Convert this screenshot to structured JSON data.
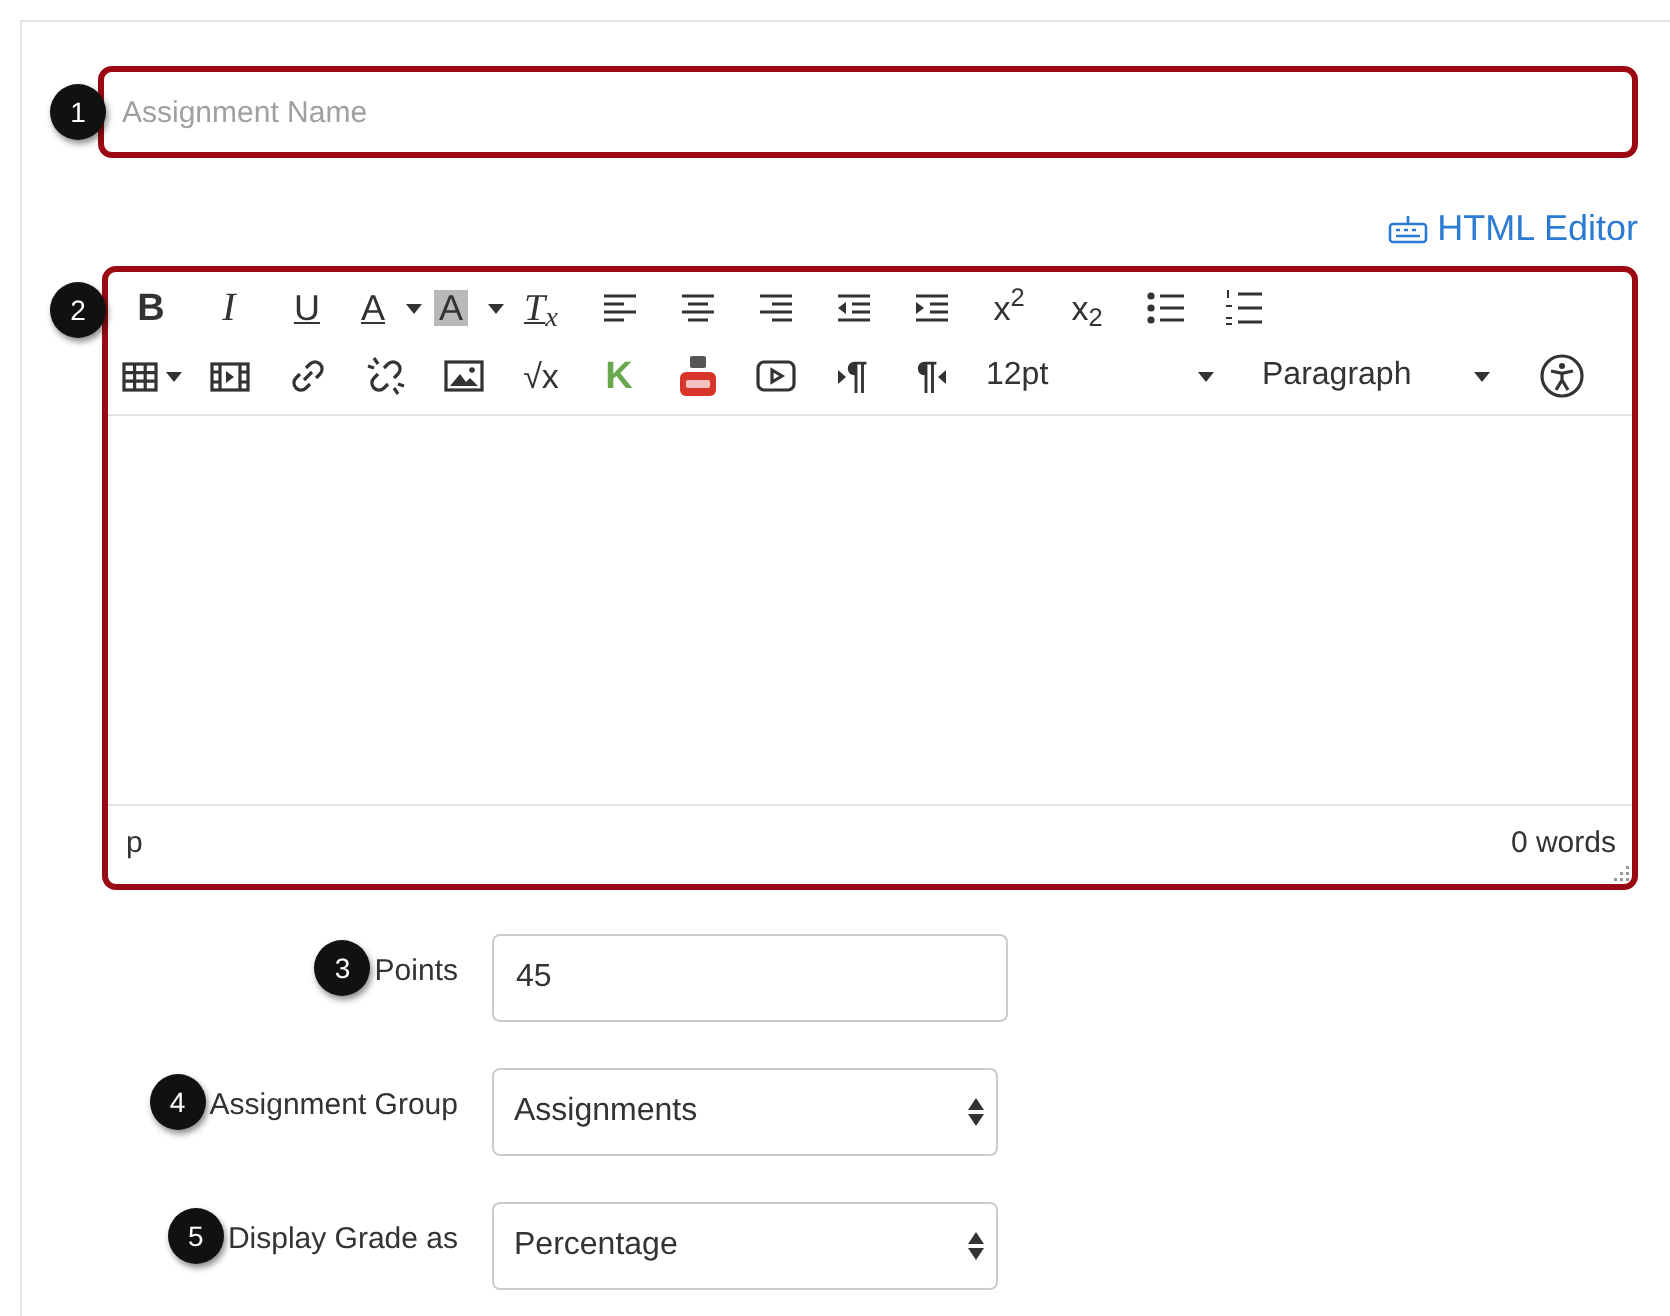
{
  "title_field": {
    "badge": "1",
    "placeholder": "Assignment Name"
  },
  "html_editor_link": "HTML Editor",
  "editor": {
    "badge": "2",
    "toolbar_rows": [
      [
        {
          "kind": "bold",
          "label": "B"
        },
        {
          "kind": "italic",
          "label": "I"
        },
        {
          "kind": "underline",
          "label": "U"
        },
        {
          "kind": "text-color",
          "label": "A"
        },
        {
          "kind": "highlight",
          "label": "A"
        },
        {
          "kind": "clear-format",
          "label": "T$_{x}$"
        },
        {
          "kind": "align-left"
        },
        {
          "kind": "align-center"
        },
        {
          "kind": "align-right"
        },
        {
          "kind": "outdent"
        },
        {
          "kind": "indent"
        },
        {
          "kind": "plain",
          "label": "x$^{2}$"
        },
        {
          "kind": "plain",
          "label": "x$_{2}$"
        },
        {
          "kind": "bullets"
        },
        {
          "kind": "numbered"
        }
      ],
      [
        {
          "kind": "table"
        },
        {
          "kind": "media"
        },
        {
          "kind": "link"
        },
        {
          "kind": "unlink"
        },
        {
          "kind": "image"
        },
        {
          "kind": "plain",
          "label": "√x"
        },
        {
          "kind": "k-logo",
          "label": "K"
        },
        {
          "kind": "youtube"
        },
        {
          "kind": "video"
        },
        {
          "kind": "ltr",
          "label": "¶"
        },
        {
          "kind": "rtl",
          "label": "¶"
        },
        {
          "kind": "select",
          "value": "12pt"
        },
        {
          "kind": "select",
          "value": "Paragraph"
        },
        {
          "kind": "accessibility"
        }
      ]
    ],
    "status_path": "p",
    "word_count": "0 words"
  },
  "fields": [
    {
      "badge": "3",
      "label": "Points",
      "kind": "input",
      "value": "45"
    },
    {
      "badge": "4",
      "label": "Assignment Group",
      "kind": "select",
      "value": "Assignments"
    },
    {
      "badge": "5",
      "label": "Display Grade as",
      "kind": "select",
      "value": "Percentage"
    }
  ]
}
